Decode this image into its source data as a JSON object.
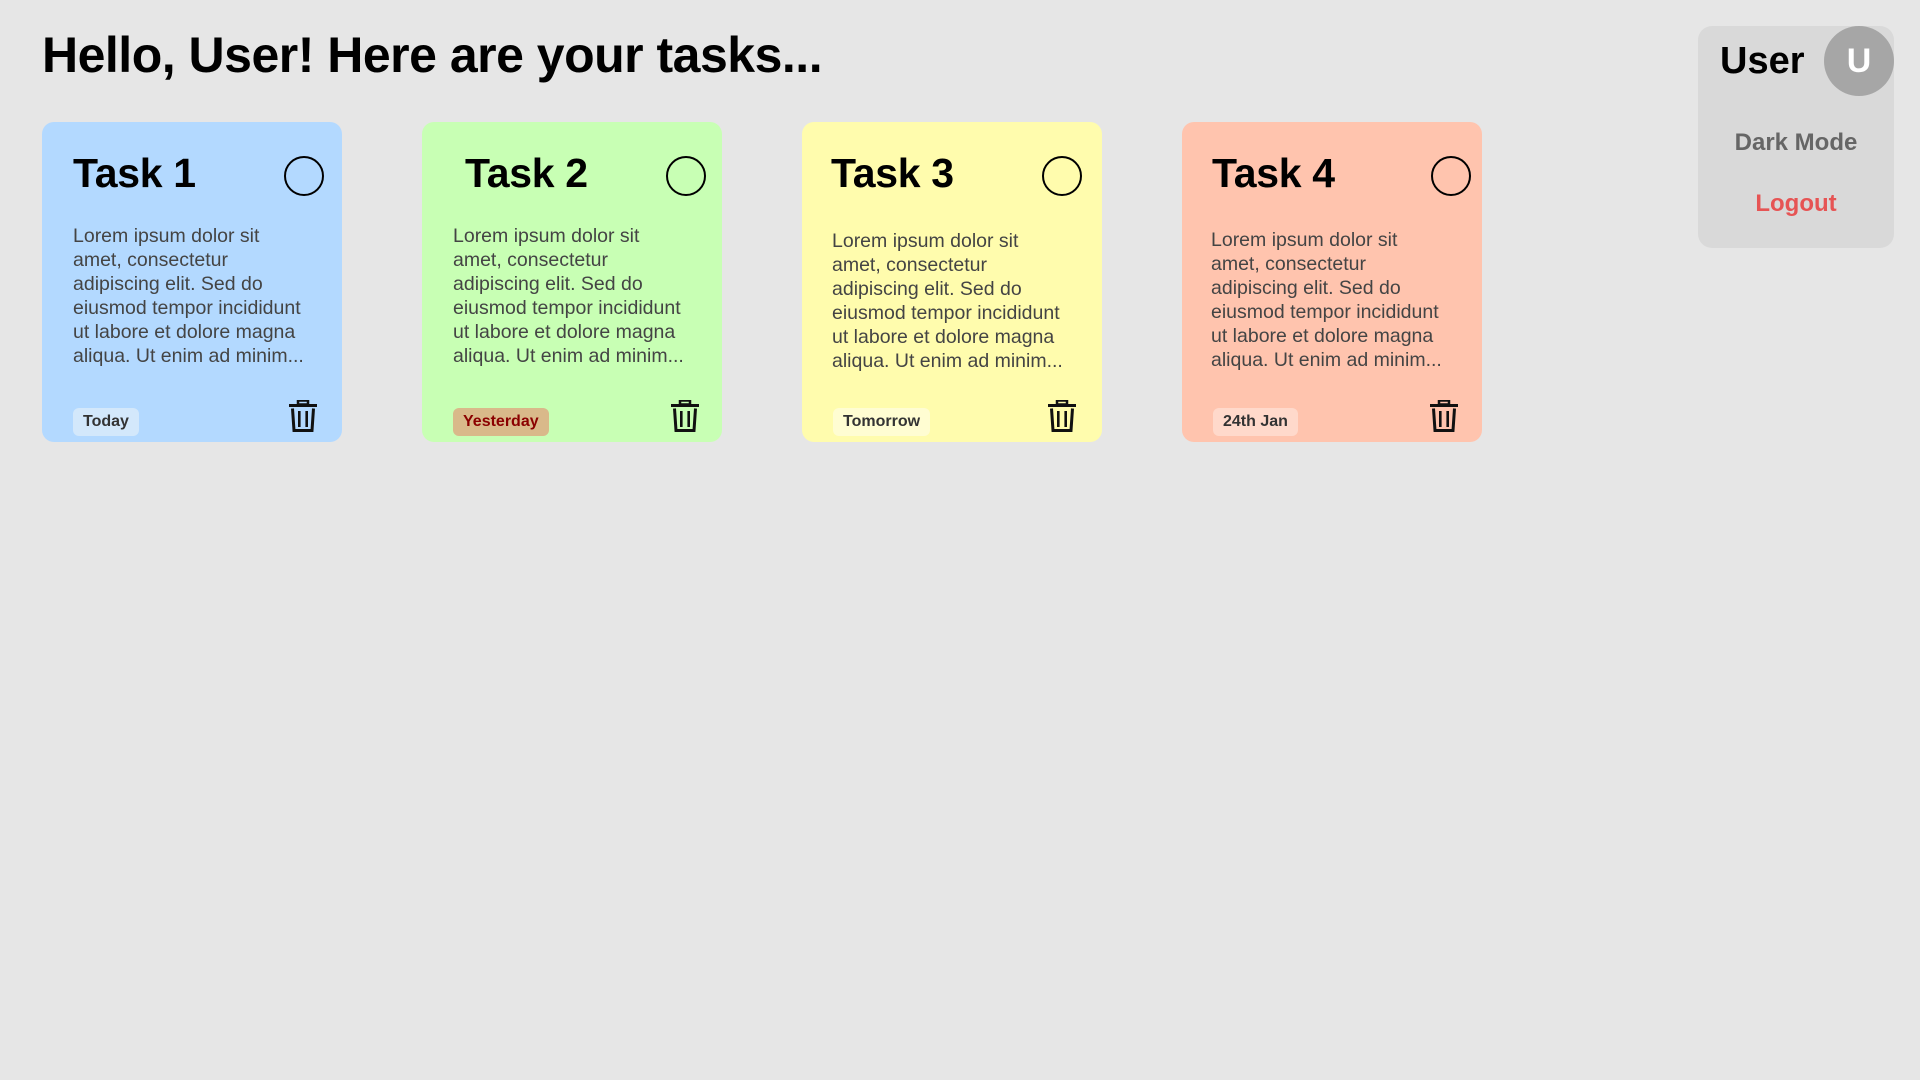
{
  "header": {
    "title": "Hello, User! Here are your tasks..."
  },
  "colors": {
    "background": "#e6e6e6",
    "menu_background": "#d9d9d9",
    "avatar": "#a6a6a6",
    "logout": "#e65454"
  },
  "tasks": [
    {
      "title": "Task 1",
      "description": "Lorem ipsum dolor sit amet, consectetur adipiscing elit. Sed do eiusmod tempor incididunt ut labore et dolore magna aliqua. Ut enim ad minim...",
      "date": "Today",
      "card_color": "#b3d9ff",
      "badge_bg": "#d3e8fb",
      "badge_color": "#333333"
    },
    {
      "title": "Task 2",
      "description": "Lorem ipsum dolor sit amet, consectetur adipiscing elit. Sed do eiusmod tempor incididunt ut labore et dolore magna aliqua. Ut enim ad minim...",
      "date": "Yesterday",
      "card_color": "#c8ffb4",
      "badge_bg": "#d9b98a",
      "badge_color": "#8b0000"
    },
    {
      "title": "Task 3",
      "description": "Lorem ipsum dolor sit amet, consectetur adipiscing elit. Sed do eiusmod tempor incididunt ut labore et dolore magna aliqua. Ut enim ad minim...",
      "date": "Tomorrow",
      "card_color": "#fffcad",
      "badge_bg": "#fffdd2",
      "badge_color": "#333333"
    },
    {
      "title": "Task 4",
      "description": "Lorem ipsum dolor sit amet, consectetur adipiscing elit. Sed do eiusmod tempor incididunt ut labore et dolore magna aliqua. Ut enim ad minim...",
      "date": "24th Jan",
      "card_color": "#ffc4ae",
      "badge_bg": "#ffd9cb",
      "badge_color": "#333333"
    }
  ],
  "user_menu": {
    "name": "User",
    "avatar_initial": "U",
    "dark_mode_label": "Dark Mode",
    "logout_label": "Logout"
  },
  "icons": {
    "complete": "circle-outline-icon",
    "delete": "trash-icon"
  }
}
